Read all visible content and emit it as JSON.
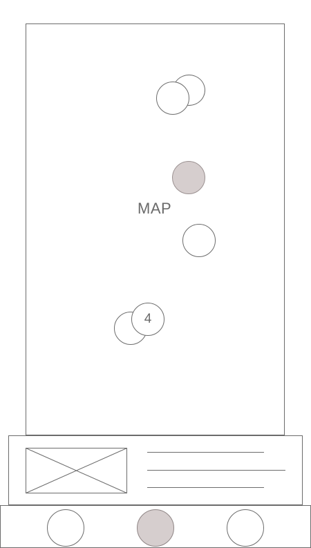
{
  "map": {
    "label": "MAP",
    "pins": [
      {
        "kind": "place-marker",
        "selected": false
      },
      {
        "kind": "place-marker",
        "selected": false
      },
      {
        "kind": "place-marker",
        "selected": true
      },
      {
        "kind": "place-marker",
        "selected": false
      },
      {
        "kind": "place-marker",
        "selected": false
      },
      {
        "kind": "cluster-marker",
        "count": "4"
      }
    ]
  },
  "info_card": {
    "thumbnail": "image-placeholder-icon",
    "text_lines": 3
  },
  "bottom_nav": {
    "buttons": [
      {
        "icon": "nav-button-circle-icon",
        "active": false
      },
      {
        "icon": "nav-button-circle-icon",
        "active": true
      },
      {
        "icon": "nav-button-circle-icon",
        "active": false
      }
    ]
  },
  "colors": {
    "stroke": "#6b6b6b",
    "highlight_fill": "#d6cece",
    "text": "#6a6a6a",
    "background": "#ffffff"
  }
}
